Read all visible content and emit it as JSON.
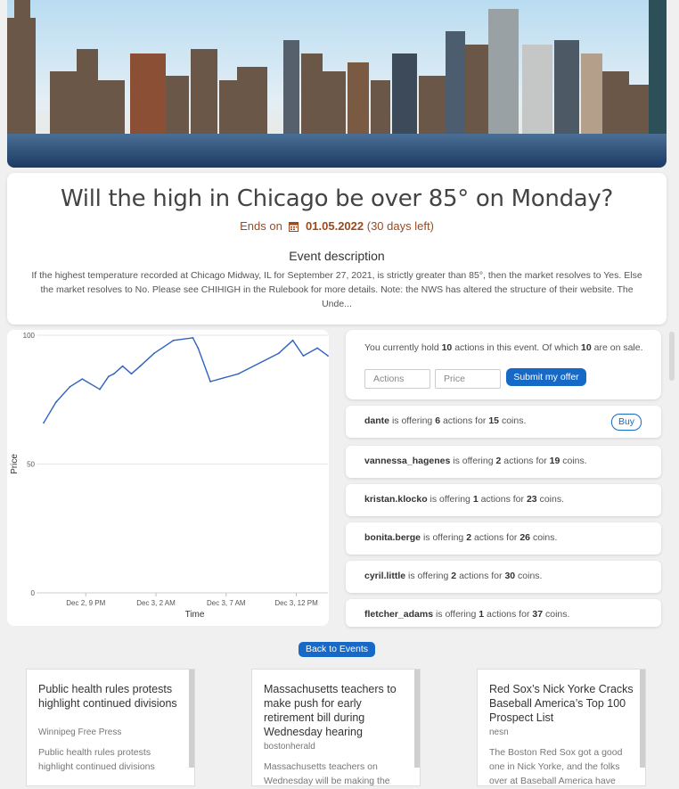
{
  "event": {
    "title": "Will the high in Chicago be over 85° on Monday?",
    "ends_prefix": "Ends on",
    "ends_date": "01.05.2022",
    "ends_remaining": "(30 days left)",
    "description_title": "Event description",
    "description": "If the highest temperature recorded at Chicago Midway, IL for September 27, 2021, is strictly greater than 85°, then the market resolves to Yes. Else the market resolves to No. Please see CHIHIGH in the Rulebook for more details. Note: the NWS has altered the structure of their website. The Unde..."
  },
  "chart_data": {
    "type": "line",
    "ylabel": "Price",
    "xlabel": "Time",
    "ylim": [
      0,
      100
    ],
    "y_ticks": [
      "0",
      "50",
      "100"
    ],
    "x_ticks": [
      "Dec 2, 9 PM",
      "Dec 3, 2 AM",
      "Dec 3, 7 AM",
      "Dec 3, 12 PM"
    ],
    "x": [
      0,
      0.7,
      1.5,
      2.2,
      3.2,
      3.7,
      4,
      4.5,
      5,
      5.5,
      6.3,
      7.4,
      8.5,
      8.8,
      9.5,
      11.1,
      13.4,
      14.2,
      14.8,
      15.6,
      16.2
    ],
    "values": [
      66,
      74,
      80,
      83,
      79,
      84,
      85,
      88,
      85,
      88,
      93,
      98,
      99,
      95,
      82,
      85,
      93,
      98,
      92,
      95,
      92
    ],
    "line_color": "#2f62c0",
    "grid": true
  },
  "holding": {
    "prefix": "You currently hold",
    "count": "10",
    "middle": "actions in this event. Of which",
    "on_sale": "10",
    "suffix": "are on sale.",
    "actions_placeholder": "Actions",
    "price_placeholder": "Price",
    "submit_label": "Submit my offer"
  },
  "offer_text": {
    "is_offering": "is offering",
    "actions_for": "actions for",
    "coins": "coins."
  },
  "offers": [
    {
      "user": "dante",
      "qty": "6",
      "price": "15",
      "buy": "Buy"
    },
    {
      "user": "vannessa_hagenes",
      "qty": "2",
      "price": "19"
    },
    {
      "user": "kristan.klocko",
      "qty": "1",
      "price": "23"
    },
    {
      "user": "bonita.berge",
      "qty": "2",
      "price": "26"
    },
    {
      "user": "cyril.little",
      "qty": "2",
      "price": "30"
    },
    {
      "user": "fletcher_adams",
      "qty": "1",
      "price": "37"
    }
  ],
  "back_label": "Back to Events",
  "news": [
    {
      "title": "Public health rules protests highlight continued divisions",
      "source": "Winnipeg Free Press",
      "body": "Public health rules protests highlight continued divisions"
    },
    {
      "title": "Massachusetts teachers to make push for early retirement bill during Wednesday hearing",
      "source": "bostonherald",
      "body": "Massachusetts teachers on Wednesday will be making the"
    },
    {
      "title": "Red Sox’s Nick Yorke Cracks Baseball America’s Top 100 Prospect List",
      "source": "nesn",
      "body": "The Boston Red Sox got a good one in Nick Yorke, and the folks over at Baseball America have"
    }
  ]
}
